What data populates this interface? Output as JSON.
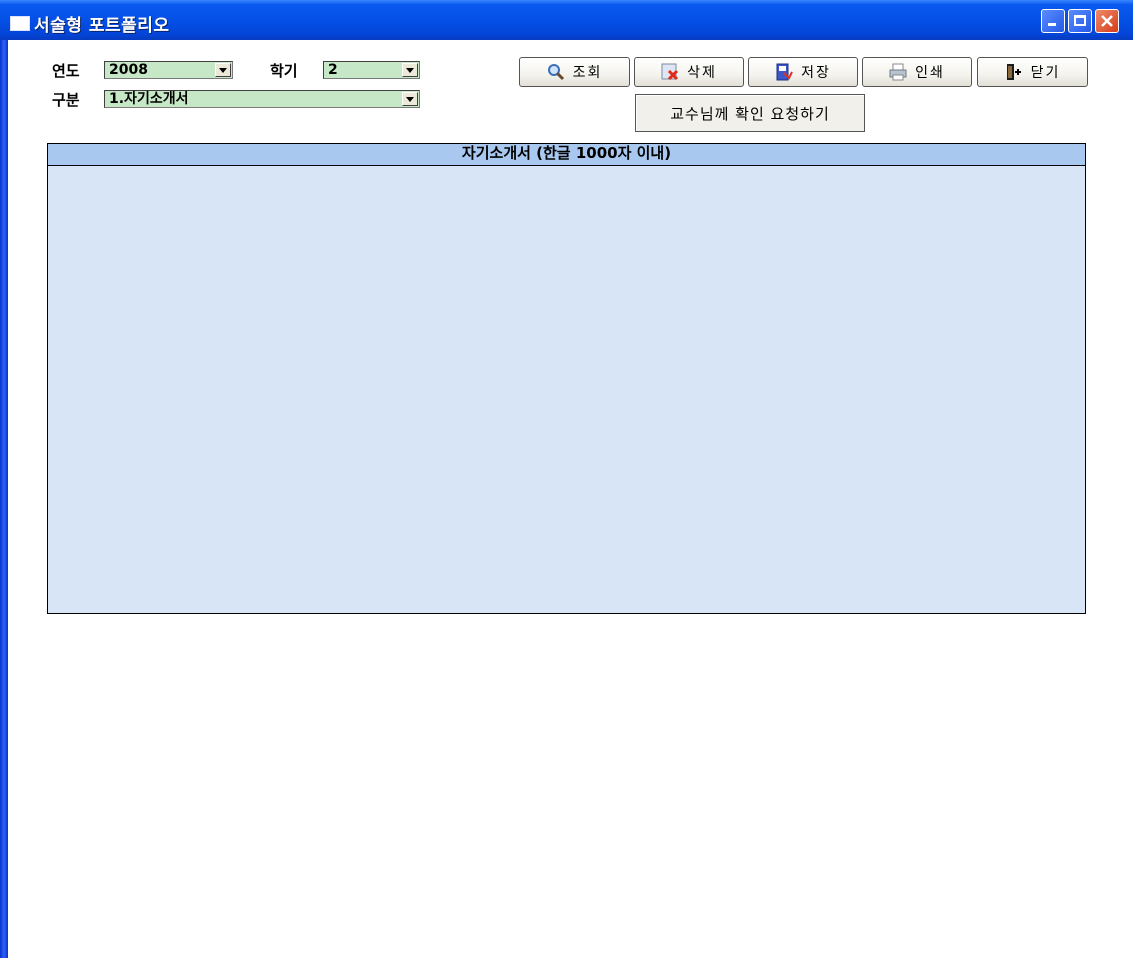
{
  "window": {
    "title": "서술형 포트폴리오"
  },
  "filters": {
    "year_label": "연도",
    "year_value": "2008",
    "semester_label": "학기",
    "semester_value": "2",
    "category_label": "구분",
    "category_value": "1.자기소개서"
  },
  "toolbar": {
    "search_label": "조회",
    "delete_label": "삭제",
    "save_label": "저장",
    "print_label": "인쇄",
    "close_label": "닫기",
    "request_confirm_label": "교수님께 확인 요청하기"
  },
  "panel": {
    "header": "자기소개서 (한글 1000자 이내)",
    "body_text": ""
  },
  "colors": {
    "title_bar": "#0550e6",
    "combo_bg": "#c7e8c7",
    "panel_header_bg": "#a9c8ef",
    "panel_body_bg": "#d8e5f7"
  },
  "icons": {
    "search": "magnifier-icon",
    "delete": "delete-icon",
    "save": "save-icon",
    "print": "printer-icon",
    "close": "exit-door-icon"
  }
}
